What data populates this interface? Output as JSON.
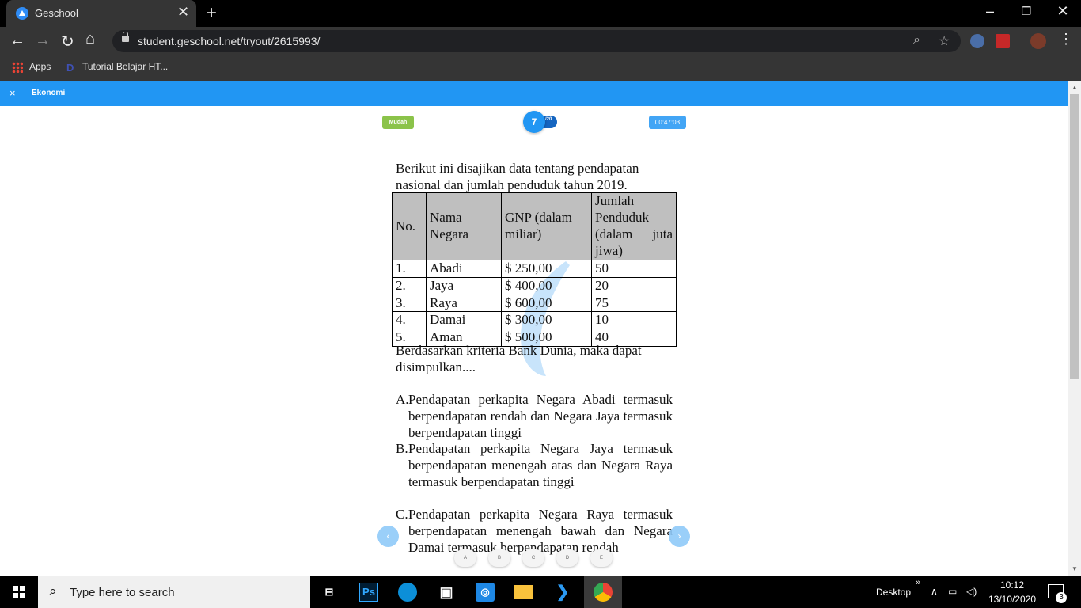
{
  "browser": {
    "tab_title": "Geschool",
    "url": "student.geschool.net/tryout/2615993/",
    "bookmarks": [
      "Apps",
      "Tutorial Belajar HT..."
    ],
    "colors": {
      "frame": "#000000",
      "toolbar": "#353535",
      "omnibox": "#202124"
    }
  },
  "app": {
    "close_label": "×",
    "subject": "Ekonomi",
    "accent": "#2196f3"
  },
  "question": {
    "difficulty": "Mudah",
    "number": "7",
    "total": "/20",
    "timer": "00:47:03",
    "intro": "Berikut ini disajikan data tentang pendapatan nasional dan jumlah penduduk tahun 2019.",
    "table": {
      "headers": [
        "No.",
        "Nama Negara",
        "GNP (dalam miliar)",
        "Jumlah Penduduk (dalam juta jiwa)"
      ],
      "rows": [
        [
          "1.",
          "Abadi",
          "$ 250,00",
          "50"
        ],
        [
          "2.",
          "Jaya",
          "$ 400,00",
          "20"
        ],
        [
          "3.",
          "Raya",
          "$ 600,00",
          "75"
        ],
        [
          "4.",
          "Damai",
          "$ 300,00",
          "10"
        ],
        [
          "5.",
          "Aman",
          "$ 500,00",
          "40"
        ]
      ]
    },
    "prompt": "Berdasarkan kriteria Bank Dunia, maka dapat disimpulkan....",
    "options": [
      {
        "letter": "A.",
        "text": "Pendapatan perkapita Negara Abadi termasuk berpendapatan rendah dan Negara Jaya termasuk berpendapatan tinggi"
      },
      {
        "letter": "B.",
        "text": "Pendapatan perkapita Negara Jaya termasuk berpendapatan menengah atas dan Negara Raya termasuk berpendapatan tinggi"
      },
      {
        "letter": "C.",
        "text": "Pendapatan perkapita Negara Raya termasuk berpendapatan menengah bawah dan Negara Damai termasuk berpendapatan rendah"
      }
    ],
    "answer_buttons": [
      "A",
      "B",
      "C",
      "D",
      "E"
    ],
    "prev_label": "‹",
    "next_label": "›"
  },
  "taskbar": {
    "search_placeholder": "Type here to search",
    "photoshop_label": "Ps",
    "desktop_label": "Desktop",
    "time": "10:12",
    "date": "13/10/2020",
    "notifications": "3"
  }
}
